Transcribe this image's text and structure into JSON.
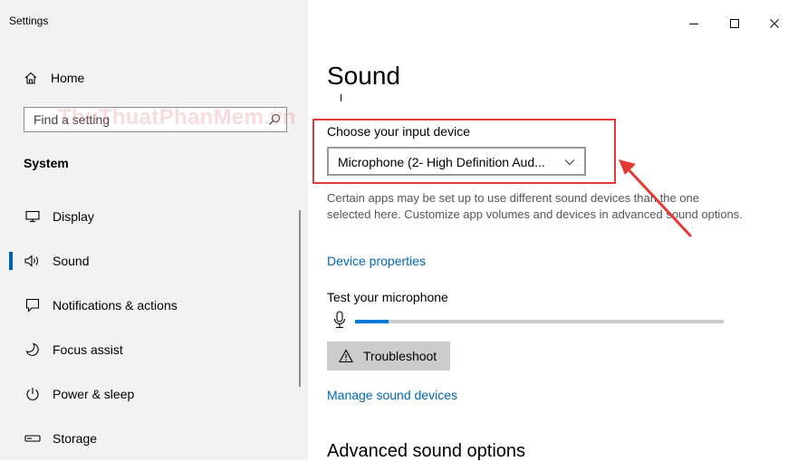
{
  "app": {
    "title": "Settings"
  },
  "sidebar": {
    "home_label": "Home",
    "search_placeholder": "Find a setting",
    "section_title": "System",
    "items": [
      {
        "label": "Display",
        "icon": "display-icon"
      },
      {
        "label": "Sound",
        "icon": "speaker-icon",
        "active": true
      },
      {
        "label": "Notifications & actions",
        "icon": "notification-icon"
      },
      {
        "label": "Focus assist",
        "icon": "moon-icon"
      },
      {
        "label": "Power & sleep",
        "icon": "power-icon"
      },
      {
        "label": "Storage",
        "icon": "storage-icon"
      }
    ]
  },
  "watermark": "ThuThuatPhanMem.vn",
  "main": {
    "title": "Sound",
    "input_device": {
      "label": "Choose your input device",
      "selected": "Microphone (2- High Definition Aud..."
    },
    "description": "Certain apps may be set up to use different sound devices than the one selected here. Customize app volumes and devices in advanced sound options.",
    "device_properties_link": "Device properties",
    "test_mic": {
      "label": "Test your microphone",
      "level": 0.09
    },
    "troubleshoot_label": "Troubleshoot",
    "manage_devices_link": "Manage sound devices",
    "advanced_title": "Advanced sound options"
  },
  "colors": {
    "accent": "#0078d7",
    "link": "#0067b8",
    "highlight": "#e53935",
    "sidebar_bg": "#f2f2f2"
  }
}
